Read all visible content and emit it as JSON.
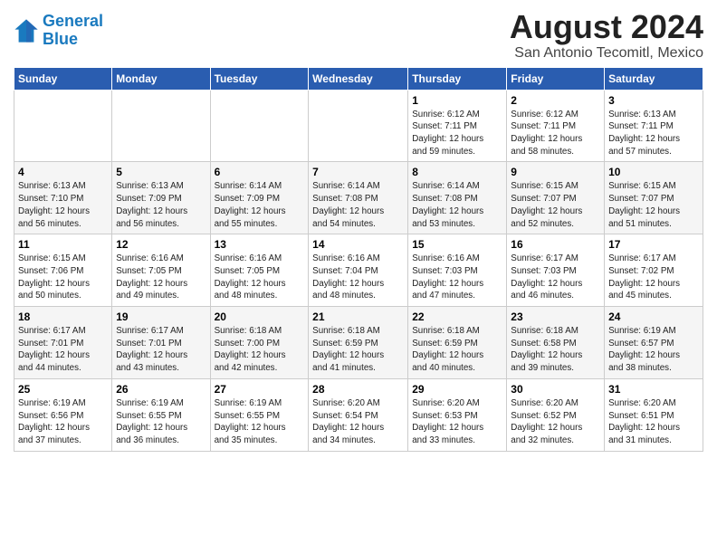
{
  "logo": {
    "line1": "General",
    "line2": "Blue"
  },
  "title": "August 2024",
  "subtitle": "San Antonio Tecomitl, Mexico",
  "headers": [
    "Sunday",
    "Monday",
    "Tuesday",
    "Wednesday",
    "Thursday",
    "Friday",
    "Saturday"
  ],
  "weeks": [
    [
      {
        "num": "",
        "info": ""
      },
      {
        "num": "",
        "info": ""
      },
      {
        "num": "",
        "info": ""
      },
      {
        "num": "",
        "info": ""
      },
      {
        "num": "1",
        "info": "Sunrise: 6:12 AM\nSunset: 7:11 PM\nDaylight: 12 hours\nand 59 minutes."
      },
      {
        "num": "2",
        "info": "Sunrise: 6:12 AM\nSunset: 7:11 PM\nDaylight: 12 hours\nand 58 minutes."
      },
      {
        "num": "3",
        "info": "Sunrise: 6:13 AM\nSunset: 7:11 PM\nDaylight: 12 hours\nand 57 minutes."
      }
    ],
    [
      {
        "num": "4",
        "info": "Sunrise: 6:13 AM\nSunset: 7:10 PM\nDaylight: 12 hours\nand 56 minutes."
      },
      {
        "num": "5",
        "info": "Sunrise: 6:13 AM\nSunset: 7:09 PM\nDaylight: 12 hours\nand 56 minutes."
      },
      {
        "num": "6",
        "info": "Sunrise: 6:14 AM\nSunset: 7:09 PM\nDaylight: 12 hours\nand 55 minutes."
      },
      {
        "num": "7",
        "info": "Sunrise: 6:14 AM\nSunset: 7:08 PM\nDaylight: 12 hours\nand 54 minutes."
      },
      {
        "num": "8",
        "info": "Sunrise: 6:14 AM\nSunset: 7:08 PM\nDaylight: 12 hours\nand 53 minutes."
      },
      {
        "num": "9",
        "info": "Sunrise: 6:15 AM\nSunset: 7:07 PM\nDaylight: 12 hours\nand 52 minutes."
      },
      {
        "num": "10",
        "info": "Sunrise: 6:15 AM\nSunset: 7:07 PM\nDaylight: 12 hours\nand 51 minutes."
      }
    ],
    [
      {
        "num": "11",
        "info": "Sunrise: 6:15 AM\nSunset: 7:06 PM\nDaylight: 12 hours\nand 50 minutes."
      },
      {
        "num": "12",
        "info": "Sunrise: 6:16 AM\nSunset: 7:05 PM\nDaylight: 12 hours\nand 49 minutes."
      },
      {
        "num": "13",
        "info": "Sunrise: 6:16 AM\nSunset: 7:05 PM\nDaylight: 12 hours\nand 48 minutes."
      },
      {
        "num": "14",
        "info": "Sunrise: 6:16 AM\nSunset: 7:04 PM\nDaylight: 12 hours\nand 48 minutes."
      },
      {
        "num": "15",
        "info": "Sunrise: 6:16 AM\nSunset: 7:03 PM\nDaylight: 12 hours\nand 47 minutes."
      },
      {
        "num": "16",
        "info": "Sunrise: 6:17 AM\nSunset: 7:03 PM\nDaylight: 12 hours\nand 46 minutes."
      },
      {
        "num": "17",
        "info": "Sunrise: 6:17 AM\nSunset: 7:02 PM\nDaylight: 12 hours\nand 45 minutes."
      }
    ],
    [
      {
        "num": "18",
        "info": "Sunrise: 6:17 AM\nSunset: 7:01 PM\nDaylight: 12 hours\nand 44 minutes."
      },
      {
        "num": "19",
        "info": "Sunrise: 6:17 AM\nSunset: 7:01 PM\nDaylight: 12 hours\nand 43 minutes."
      },
      {
        "num": "20",
        "info": "Sunrise: 6:18 AM\nSunset: 7:00 PM\nDaylight: 12 hours\nand 42 minutes."
      },
      {
        "num": "21",
        "info": "Sunrise: 6:18 AM\nSunset: 6:59 PM\nDaylight: 12 hours\nand 41 minutes."
      },
      {
        "num": "22",
        "info": "Sunrise: 6:18 AM\nSunset: 6:59 PM\nDaylight: 12 hours\nand 40 minutes."
      },
      {
        "num": "23",
        "info": "Sunrise: 6:18 AM\nSunset: 6:58 PM\nDaylight: 12 hours\nand 39 minutes."
      },
      {
        "num": "24",
        "info": "Sunrise: 6:19 AM\nSunset: 6:57 PM\nDaylight: 12 hours\nand 38 minutes."
      }
    ],
    [
      {
        "num": "25",
        "info": "Sunrise: 6:19 AM\nSunset: 6:56 PM\nDaylight: 12 hours\nand 37 minutes."
      },
      {
        "num": "26",
        "info": "Sunrise: 6:19 AM\nSunset: 6:55 PM\nDaylight: 12 hours\nand 36 minutes."
      },
      {
        "num": "27",
        "info": "Sunrise: 6:19 AM\nSunset: 6:55 PM\nDaylight: 12 hours\nand 35 minutes."
      },
      {
        "num": "28",
        "info": "Sunrise: 6:20 AM\nSunset: 6:54 PM\nDaylight: 12 hours\nand 34 minutes."
      },
      {
        "num": "29",
        "info": "Sunrise: 6:20 AM\nSunset: 6:53 PM\nDaylight: 12 hours\nand 33 minutes."
      },
      {
        "num": "30",
        "info": "Sunrise: 6:20 AM\nSunset: 6:52 PM\nDaylight: 12 hours\nand 32 minutes."
      },
      {
        "num": "31",
        "info": "Sunrise: 6:20 AM\nSunset: 6:51 PM\nDaylight: 12 hours\nand 31 minutes."
      }
    ]
  ]
}
